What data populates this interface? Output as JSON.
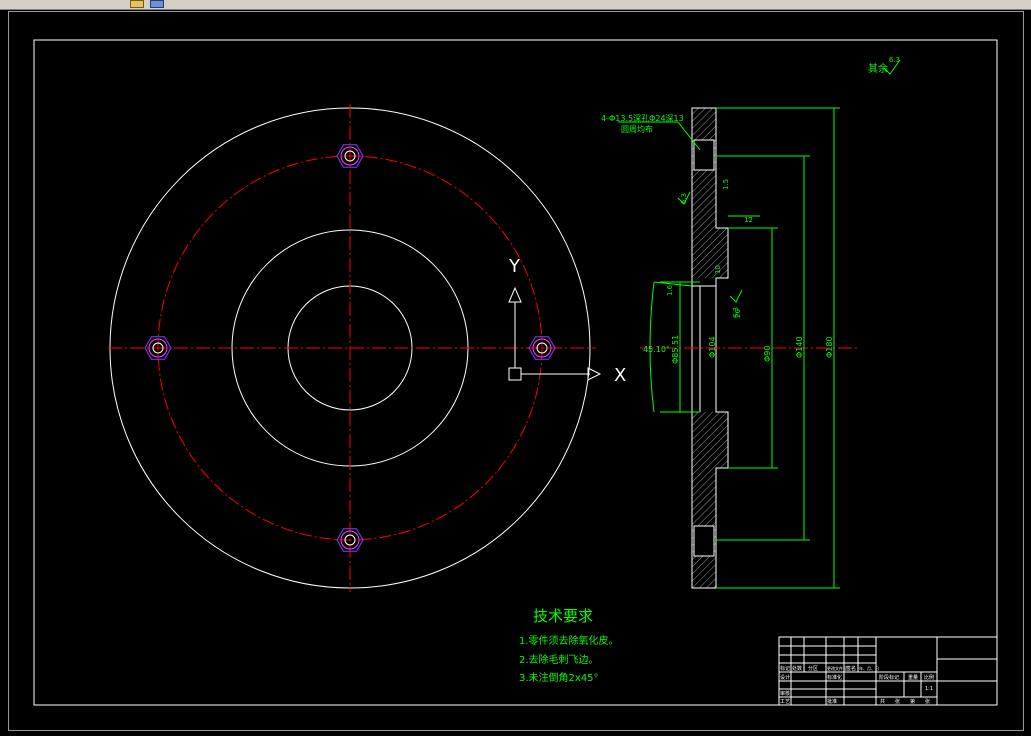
{
  "roughness_note": "其余",
  "roughness_value": "6.3",
  "hole_callout_line1": "4-Φ13.5深孔Φ24深13",
  "hole_callout_line2": "圆周均布",
  "axis_y_label": "Y",
  "axis_x_label": "X",
  "dims": {
    "d180": "Φ180",
    "d140": "Φ140",
    "d104": "Φ104",
    "d85": "Φ85.51",
    "d_inner_label": "Φ90",
    "angle": "45.10°",
    "r15": "1.5",
    "r16": "1.6",
    "r10": "10",
    "r12": "12",
    "r20": "20",
    "v63a": "6.3",
    "v63b": "6.3"
  },
  "tech_title": "技术要求",
  "tech_items": [
    "1.零件须去除氧化皮。",
    "2.去除毛刺飞边。",
    "3.未注倒角2x45°"
  ],
  "title_block": {
    "row_labels": [
      "标记",
      "处数",
      "分区",
      "更改文件号",
      "签名",
      "年、月、日"
    ],
    "designer": "设计",
    "standard": "标准化",
    "checker": "审核",
    "process": "工艺",
    "approve": "批准",
    "stage": "阶段标记",
    "weight": "重量",
    "scale": "比例",
    "scale_val": "1:1",
    "sheet_a": "共",
    "sheet_b": "张",
    "sheet_c": "第",
    "sheet_d": "张"
  },
  "colors": {
    "background": "#000000",
    "outline": "#ffffff",
    "center_line": "#ff0000",
    "dimension": "#00ff00",
    "hole_hex": "#8040ff"
  }
}
